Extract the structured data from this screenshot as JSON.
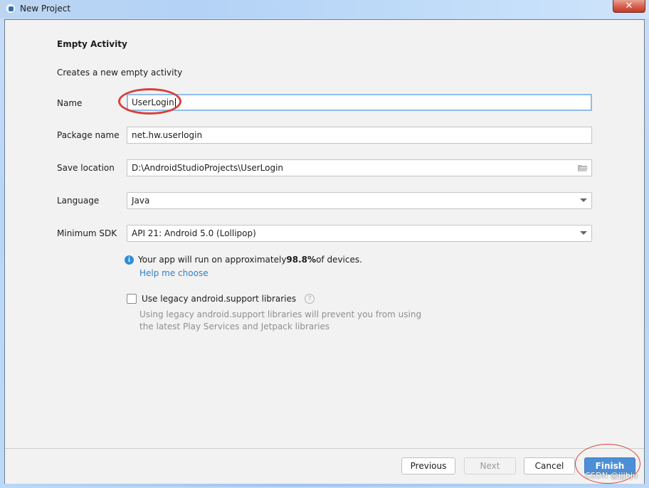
{
  "window": {
    "title": "New Project",
    "app_icon": "android-studio-icon",
    "close_glyph": "✕"
  },
  "page": {
    "heading": "Empty Activity",
    "subtitle": "Creates a new empty activity"
  },
  "form": {
    "name": {
      "label": "Name",
      "value": "UserLogin"
    },
    "package": {
      "label": "Package name",
      "value": "net.hw.userlogin"
    },
    "save_location": {
      "label": "Save location",
      "value": "D:\\AndroidStudioProjects\\UserLogin",
      "icon": "folder-icon"
    },
    "language": {
      "label": "Language",
      "value": "Java",
      "icon": "chevron-down-icon"
    },
    "min_sdk": {
      "label": "Minimum SDK",
      "value": "API 21: Android 5.0 (Lollipop)",
      "icon": "chevron-down-icon"
    }
  },
  "info": {
    "icon_glyph": "i",
    "text_before": "Your app will run on approximately ",
    "percent": "98.8%",
    "text_after": " of devices.",
    "help_link": "Help me choose"
  },
  "legacy": {
    "checked": false,
    "label": "Use legacy android.support libraries",
    "help_glyph": "?",
    "hint_line1": "Using legacy android.support libraries will prevent you from using",
    "hint_line2": "the latest Play Services and Jetpack libraries"
  },
  "buttons": {
    "previous": "Previous",
    "next": "Next",
    "cancel": "Cancel",
    "finish": "Finish"
  },
  "colors": {
    "accent": "#4d8fd6",
    "link": "#2f7fc8",
    "focus_border": "#90bde9",
    "annotation": "#d9403a"
  },
  "watermark": "CSDN @jjjhju"
}
